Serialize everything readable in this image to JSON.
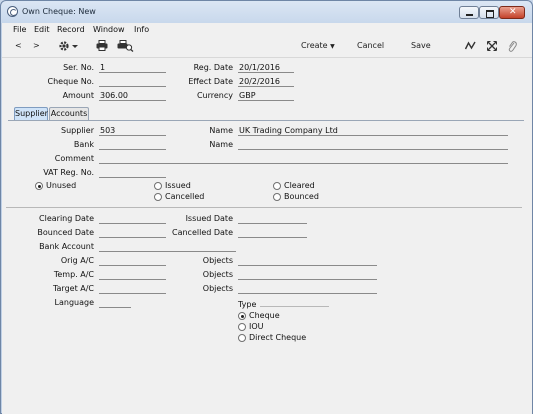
{
  "window": {
    "title": "Own Cheque: New"
  },
  "menu": [
    "File",
    "Edit",
    "Record",
    "Window",
    "Info"
  ],
  "toolbar": {
    "back": "<",
    "forward": ">",
    "create_label": "Create",
    "cancel_label": "Cancel",
    "save_label": "Save"
  },
  "header": {
    "ser_no_label": "Ser. No.",
    "ser_no": "1",
    "cheque_no_label": "Cheque No.",
    "cheque_no": "",
    "amount_label": "Amount",
    "amount": "306.00",
    "reg_date_label": "Reg. Date",
    "reg_date": "20/1/2016",
    "effect_date_label": "Effect Date",
    "effect_date": "20/2/2016",
    "currency_label": "Currency",
    "currency": "GBP"
  },
  "tabs": [
    "Supplier",
    "Accounts"
  ],
  "supplier": {
    "supplier_label": "Supplier",
    "supplier": "503",
    "name_label": "Name",
    "name": "UK Trading Company Ltd",
    "bank_label": "Bank",
    "bank": "",
    "bank_name_label": "Name",
    "bank_name": "",
    "comment_label": "Comment",
    "comment": "",
    "vat_label": "VAT Reg. No.",
    "vat": "",
    "status_options": [
      "Unused",
      "Issued",
      "Cleared",
      "Cancelled",
      "Bounced"
    ],
    "status_selected": "Unused"
  },
  "details": {
    "clearing_date_label": "Clearing Date",
    "issued_date_label": "Issued Date",
    "bounced_date_label": "Bounced Date",
    "cancelled_date_label": "Cancelled Date",
    "bank_account_label": "Bank Account",
    "orig_ac_label": "Orig A/C",
    "temp_ac_label": "Temp. A/C",
    "target_ac_label": "Target A/C",
    "objects_label": "Objects",
    "language_label": "Language",
    "type_label": "Type",
    "type_options": [
      "Cheque",
      "IOU",
      "Direct Cheque"
    ],
    "type_selected": "Cheque"
  }
}
